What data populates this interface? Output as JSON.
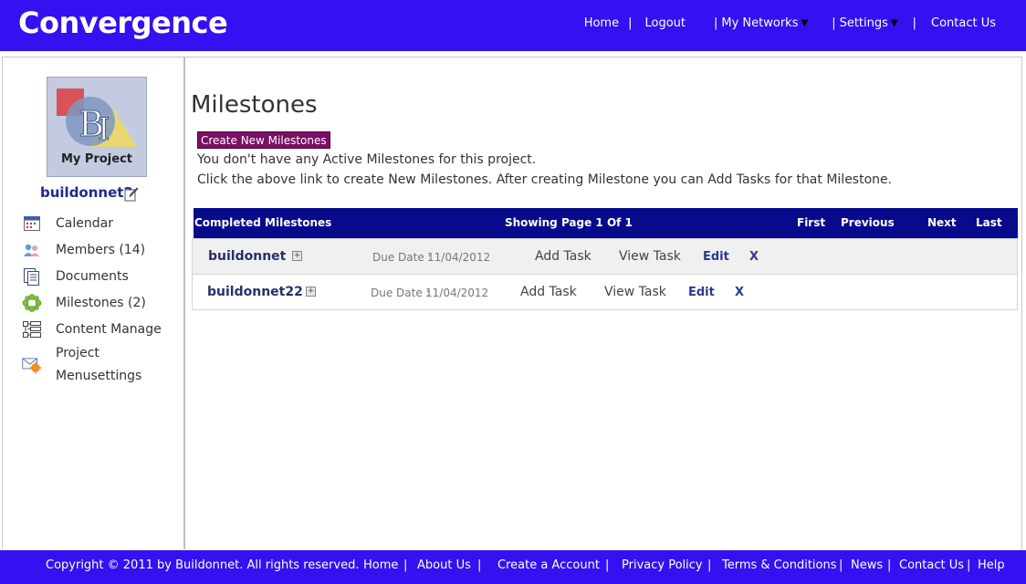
{
  "header": {
    "brand": "Convergence",
    "nav": [
      "Home",
      "Logout",
      "My Networks",
      "Settings",
      "Contact Us"
    ]
  },
  "sidebar": {
    "thumb_caption": "My Project",
    "project_name": "buildonnet2",
    "items": [
      {
        "label": "Calendar",
        "icon": "calendar-icon"
      },
      {
        "label": "Members (14)",
        "icon": "members-icon"
      },
      {
        "label": "Documents",
        "icon": "documents-icon"
      },
      {
        "label": "Milestones (2)",
        "icon": "milestones-icon"
      },
      {
        "label": "Content Manage",
        "icon": "content-manage-icon"
      },
      {
        "label": "Project",
        "label2": "Menusettings",
        "icon": "menusettings-icon"
      }
    ]
  },
  "main": {
    "title": "Milestones",
    "create_button": "Create New Milestones",
    "message1": "You don't have any Active Milestones for this project.",
    "message2": "Click the above link to create New Milestones. After creating Milestone you can Add Tasks for that Milestone.",
    "table": {
      "heading": "Completed Milestones",
      "page_info": "Showing Page 1 Of 1",
      "pager": {
        "first": "First",
        "previous": "Previous",
        "next": "Next",
        "last": "Last"
      },
      "rows": [
        {
          "name": "buildonnet",
          "due_label": "Due Date :",
          "due_date": "11/04/2012",
          "add_task": "Add Task",
          "view_task": "View Task",
          "edit": "Edit",
          "delete": "X"
        },
        {
          "name": "buildonnet22",
          "due_label": "Due Date :",
          "due_date": "11/04/2012",
          "add_task": "Add Task",
          "view_task": "View Task",
          "edit": "Edit",
          "delete": "X"
        }
      ]
    }
  },
  "footer": {
    "copyright": "Copyright © 2011 by Buildonnet. All rights reserved.",
    "links": [
      "Home",
      "About Us",
      "Create a Account",
      "Privacy Policy",
      "Terms & Conditions",
      "News",
      "Contact Us",
      "Help"
    ]
  },
  "colors": {
    "header_bg": "#3510f0",
    "table_head_bg": "#080a8c",
    "create_button_bg": "#7a0f65",
    "link_blue": "#1c2b8f"
  }
}
